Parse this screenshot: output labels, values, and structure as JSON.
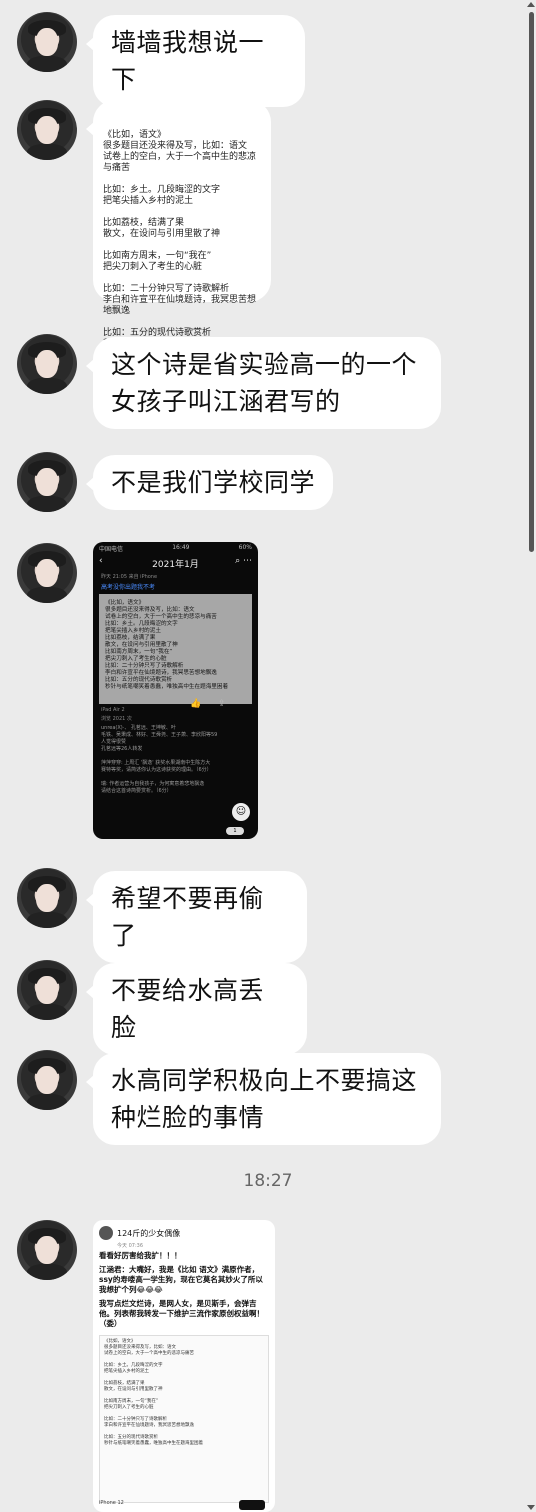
{
  "messages": {
    "m1": "墙墙我想说一下",
    "m2_poem": "《比如，语文》\n很多题目还没来得及写，比如：语文\n试卷上的空白，大于一个高中生的悲凉与痛苦\n\n比如：乡土。几段晦涩的文字\n把笔尖插入乡村的泥土\n\n比如荔枝，结满了果\n散文，在设问与引用里散了神\n\n比如南方周末，一句“我在”\n把尖刀刺入了考生的心脏\n\n比如：二十分钟只写了诗歌解析\n李白和许宣平在仙境题诗，我冥思苦想地飘逸\n\n比如：五分的现代诗歌赏析\n秒针与纸笔嘲笑着愚蠢，唯独高中生在题海里困着",
    "m3": "这个诗是省实验高一的一个女孩子叫江涵君写的",
    "m4": "不是我们学校同学",
    "m5": "希望不要再偷了",
    "m6": "不要给水高丢脸",
    "m7": "水高同学积极向上不要搞这种烂脸的事情"
  },
  "timestamp": "18:27",
  "phone_screenshot": {
    "status_left": "中国电信",
    "status_time": "16:49",
    "status_right": "60%",
    "nav_title": "2021年1月",
    "nav_back": "‹",
    "nav_right": "⌕ ⋯",
    "meta_small": "昨天 21:05   来自 iPhone",
    "link_text": "高考没你出题我不考",
    "poem": "《比如，语文》\n很多题目还没来得及写，比如：语文\n试卷上的空白，大于一个高中生的悲凉与痛苦\n比如：乡土。几段晦涩的文字\n把笔尖插入乡村的泥土\n比如荔枝，结满了果\n散文，在设问与引用里散了神\n比如南方周末，一句“我在”\n把尖刀刺入了考生的心脏\n比如：二十分钟只写了诗歌解析\n李白和许宣平在仙境题诗，我冥思苦想地飘逸\n比如：五分的现代诗歌赏析\n秒针与纸笔嘲笑着愚蠢，唯独高中生在题海里困着",
    "device": "iPad Air 2",
    "views": "浏览 2021 次",
    "bottom_meta": "unrea(X)·、 孔茗远、王坤敏、叶\n毛铁、吴秉成、林好、王舜尧、王子萧、李欣阳等59\n人觉得很赞\n孔茗远等26人转发\n\n萍萍穿穿: 上周汇 '飘逸' 获奖水果湖南中生陈方大\n赛特等奖，请简述你认为这诗获奖的理由。（6分）\n\n瑞: 作者运营为自我孩子，为何寓意着悲地飘逸\n请结合这首诗简要赏析。（6分）",
    "like_icon": "👍",
    "share_icon": "⇪",
    "fab_icon": "☺",
    "pill": "1"
  },
  "card2": {
    "name": "124斤的少女偶像",
    "time": "今天 07:36",
    "line1": "看看好厉害给我扩！！！",
    "line2": "江涵君：大嘴好，我是《比如 语文》满原作者，ssy的寿喽高一学生狗，现在它莫名其妙火了所以我想扩个列😂😂😂",
    "line3": "我写点烂文烂诗，是网人女，是贝斯手，会弹吉他。列表帮我转发一下维护三流作家原创权益啊！（委）",
    "inner": "《比如，语文》\n很多题目还没来得及写，比如：语文\n试卷上的空白，大于一个高中生的悲凉与痛苦\n\n比如：乡土。几段晦涩的文字\n把笔尖插入乡村的泥土\n\n比如荔枝，结满了果\n散文，在设问与引用里散了神\n\n比如南方周末，一句“我在”\n把尖刀刺入了考生的心脏\n\n比如：二十分钟只写了诗歌解析\n李白和许宣平在仙境题诗，我冥思苦想地飘逸\n\n比如：五分的现代诗歌赏析\n秒针与纸笔嘲笑着愚蠢，唯独高中生在题海里困着",
    "foot": "iPhone 12"
  }
}
